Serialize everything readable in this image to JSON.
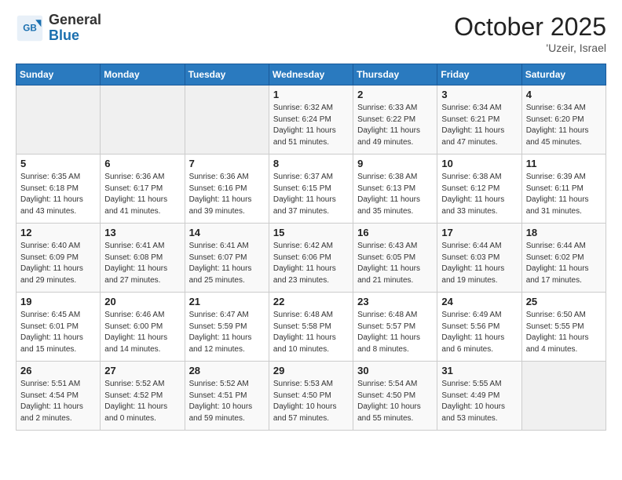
{
  "header": {
    "logo_general": "General",
    "logo_blue": "Blue",
    "month_title": "October 2025",
    "location": "'Uzeir, Israel"
  },
  "weekdays": [
    "Sunday",
    "Monday",
    "Tuesday",
    "Wednesday",
    "Thursday",
    "Friday",
    "Saturday"
  ],
  "weeks": [
    [
      {
        "day": "",
        "info": ""
      },
      {
        "day": "",
        "info": ""
      },
      {
        "day": "",
        "info": ""
      },
      {
        "day": "1",
        "info": "Sunrise: 6:32 AM\nSunset: 6:24 PM\nDaylight: 11 hours\nand 51 minutes."
      },
      {
        "day": "2",
        "info": "Sunrise: 6:33 AM\nSunset: 6:22 PM\nDaylight: 11 hours\nand 49 minutes."
      },
      {
        "day": "3",
        "info": "Sunrise: 6:34 AM\nSunset: 6:21 PM\nDaylight: 11 hours\nand 47 minutes."
      },
      {
        "day": "4",
        "info": "Sunrise: 6:34 AM\nSunset: 6:20 PM\nDaylight: 11 hours\nand 45 minutes."
      }
    ],
    [
      {
        "day": "5",
        "info": "Sunrise: 6:35 AM\nSunset: 6:18 PM\nDaylight: 11 hours\nand 43 minutes."
      },
      {
        "day": "6",
        "info": "Sunrise: 6:36 AM\nSunset: 6:17 PM\nDaylight: 11 hours\nand 41 minutes."
      },
      {
        "day": "7",
        "info": "Sunrise: 6:36 AM\nSunset: 6:16 PM\nDaylight: 11 hours\nand 39 minutes."
      },
      {
        "day": "8",
        "info": "Sunrise: 6:37 AM\nSunset: 6:15 PM\nDaylight: 11 hours\nand 37 minutes."
      },
      {
        "day": "9",
        "info": "Sunrise: 6:38 AM\nSunset: 6:13 PM\nDaylight: 11 hours\nand 35 minutes."
      },
      {
        "day": "10",
        "info": "Sunrise: 6:38 AM\nSunset: 6:12 PM\nDaylight: 11 hours\nand 33 minutes."
      },
      {
        "day": "11",
        "info": "Sunrise: 6:39 AM\nSunset: 6:11 PM\nDaylight: 11 hours\nand 31 minutes."
      }
    ],
    [
      {
        "day": "12",
        "info": "Sunrise: 6:40 AM\nSunset: 6:09 PM\nDaylight: 11 hours\nand 29 minutes."
      },
      {
        "day": "13",
        "info": "Sunrise: 6:41 AM\nSunset: 6:08 PM\nDaylight: 11 hours\nand 27 minutes."
      },
      {
        "day": "14",
        "info": "Sunrise: 6:41 AM\nSunset: 6:07 PM\nDaylight: 11 hours\nand 25 minutes."
      },
      {
        "day": "15",
        "info": "Sunrise: 6:42 AM\nSunset: 6:06 PM\nDaylight: 11 hours\nand 23 minutes."
      },
      {
        "day": "16",
        "info": "Sunrise: 6:43 AM\nSunset: 6:05 PM\nDaylight: 11 hours\nand 21 minutes."
      },
      {
        "day": "17",
        "info": "Sunrise: 6:44 AM\nSunset: 6:03 PM\nDaylight: 11 hours\nand 19 minutes."
      },
      {
        "day": "18",
        "info": "Sunrise: 6:44 AM\nSunset: 6:02 PM\nDaylight: 11 hours\nand 17 minutes."
      }
    ],
    [
      {
        "day": "19",
        "info": "Sunrise: 6:45 AM\nSunset: 6:01 PM\nDaylight: 11 hours\nand 15 minutes."
      },
      {
        "day": "20",
        "info": "Sunrise: 6:46 AM\nSunset: 6:00 PM\nDaylight: 11 hours\nand 14 minutes."
      },
      {
        "day": "21",
        "info": "Sunrise: 6:47 AM\nSunset: 5:59 PM\nDaylight: 11 hours\nand 12 minutes."
      },
      {
        "day": "22",
        "info": "Sunrise: 6:48 AM\nSunset: 5:58 PM\nDaylight: 11 hours\nand 10 minutes."
      },
      {
        "day": "23",
        "info": "Sunrise: 6:48 AM\nSunset: 5:57 PM\nDaylight: 11 hours\nand 8 minutes."
      },
      {
        "day": "24",
        "info": "Sunrise: 6:49 AM\nSunset: 5:56 PM\nDaylight: 11 hours\nand 6 minutes."
      },
      {
        "day": "25",
        "info": "Sunrise: 6:50 AM\nSunset: 5:55 PM\nDaylight: 11 hours\nand 4 minutes."
      }
    ],
    [
      {
        "day": "26",
        "info": "Sunrise: 5:51 AM\nSunset: 4:54 PM\nDaylight: 11 hours\nand 2 minutes."
      },
      {
        "day": "27",
        "info": "Sunrise: 5:52 AM\nSunset: 4:52 PM\nDaylight: 11 hours\nand 0 minutes."
      },
      {
        "day": "28",
        "info": "Sunrise: 5:52 AM\nSunset: 4:51 PM\nDaylight: 10 hours\nand 59 minutes."
      },
      {
        "day": "29",
        "info": "Sunrise: 5:53 AM\nSunset: 4:50 PM\nDaylight: 10 hours\nand 57 minutes."
      },
      {
        "day": "30",
        "info": "Sunrise: 5:54 AM\nSunset: 4:50 PM\nDaylight: 10 hours\nand 55 minutes."
      },
      {
        "day": "31",
        "info": "Sunrise: 5:55 AM\nSunset: 4:49 PM\nDaylight: 10 hours\nand 53 minutes."
      },
      {
        "day": "",
        "info": ""
      }
    ]
  ]
}
